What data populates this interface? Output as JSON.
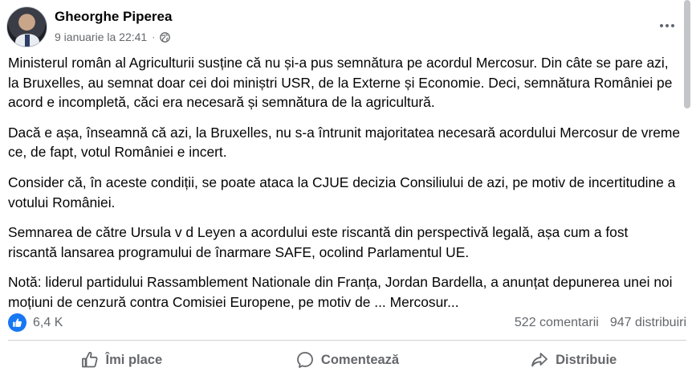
{
  "post": {
    "author": "Gheorghe Piperea",
    "timestamp": "9 ianuarie la 22:41",
    "separator": "·",
    "audience_icon": "globe-icon",
    "more_icon": "more-options-icon",
    "paragraphs": [
      "Ministerul român al Agriculturii susține că nu și-a pus semnătura pe acordul Mercosur. Din câte se pare azi, la Bruxelles, au semnat doar cei doi miniștri USR, de la Externe și Economie. Deci, semnătura României pe acord e incompletă, căci era necesară și semnătura de la agricultură.",
      "Dacă e așa, înseamnă că azi, la Bruxelles, nu s-a întrunit majoritatea necesară acordului Mercosur de vreme ce, de fapt, votul României e incert.",
      "Consider că, în aceste condiții, se poate ataca la CJUE decizia Consiliului de azi, pe motiv de incertitudine a votului României.",
      "Semnarea de către Ursula v d Leyen a acordului este riscantă din perspectivă legală, așa cum a fost riscantă lansarea programului de înarmare SAFE, ocolind Parlamentul UE.",
      "Notă: liderul partidului Rassamblement Nationale din Franța, Jordan Bardella, a anunțat depunerea unei noi moțiuni de cenzură contra Comisiei Europene, pe motiv de ... Mercosur..."
    ]
  },
  "stats": {
    "reactions": "6,4 K",
    "comments": "522 comentarii",
    "shares": "947 distribuiri"
  },
  "actions": {
    "like": "Îmi place",
    "comment": "Comentează",
    "share": "Distribuie"
  },
  "colors": {
    "accent": "#1877f2",
    "secondary_text": "#65676b",
    "primary_text": "#050505"
  }
}
